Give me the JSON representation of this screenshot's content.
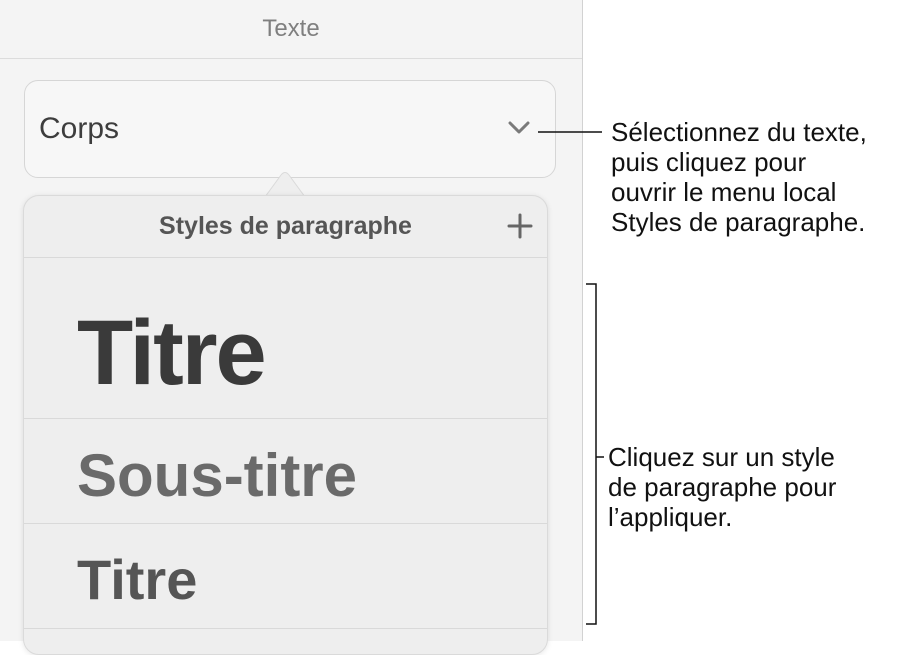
{
  "panel": {
    "header_title": "Texte",
    "paragraph_style_value": "Corps"
  },
  "popover": {
    "title": "Styles de paragraphe",
    "styles": [
      "Titre",
      "Sous-titre",
      "Titre"
    ]
  },
  "callouts": {
    "select_hint": [
      "Sélectionnez du texte,",
      "puis cliquez pour",
      "ouvrir le menu local",
      "Styles de paragraphe."
    ],
    "apply_hint": [
      "Cliquez sur un style",
      "de paragraphe pour",
      "l’appliquer."
    ]
  },
  "icons": {
    "dropdown": "chevron-down-icon",
    "add": "plus-icon"
  },
  "colors": {
    "panel_bg": "#f4f4f4",
    "popover_bg": "#eeeeee",
    "text_dark": "#3a3a3a"
  }
}
